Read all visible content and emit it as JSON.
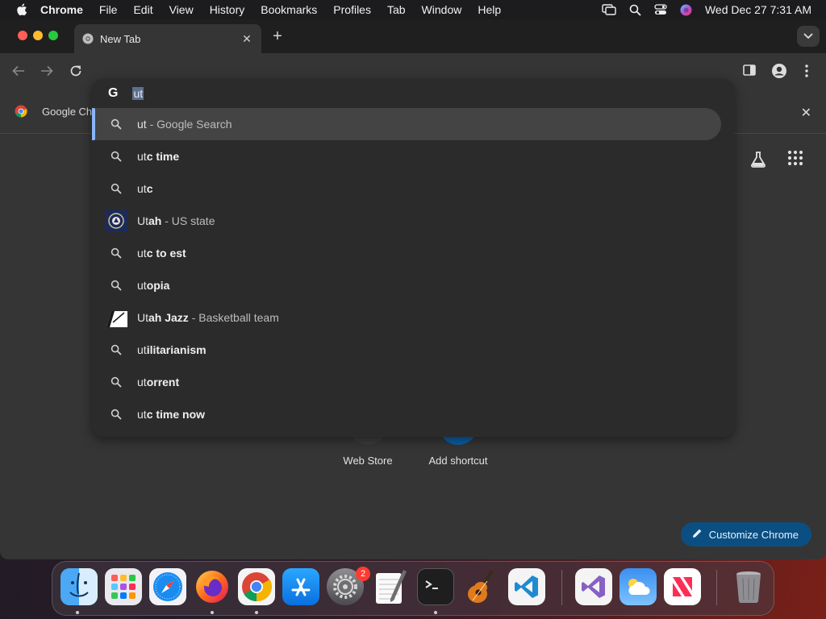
{
  "menubar": {
    "app_name": "Chrome",
    "menus": [
      "File",
      "Edit",
      "View",
      "History",
      "Bookmarks",
      "Profiles",
      "Tab",
      "Window",
      "Help"
    ],
    "clock": "Wed Dec 27  7:31 AM"
  },
  "tab": {
    "title": "New Tab",
    "close_glyph": "✕",
    "new_tab_glyph": "+"
  },
  "omnibox": {
    "logo": "G",
    "typed": "ut",
    "suggestions": [
      {
        "kind": "search",
        "typed": "ut",
        "rest": "",
        "detail": " - Google Search"
      },
      {
        "kind": "search",
        "typed": "ut",
        "rest": "c time",
        "detail": ""
      },
      {
        "kind": "search",
        "typed": "ut",
        "rest": "c",
        "detail": ""
      },
      {
        "kind": "entity",
        "icon": "utah-seal-icon",
        "typed": "Ut",
        "rest": "ah",
        "detail": " - US state"
      },
      {
        "kind": "search",
        "typed": "ut",
        "rest": "c to est",
        "detail": ""
      },
      {
        "kind": "search",
        "typed": "ut",
        "rest": "opia",
        "detail": ""
      },
      {
        "kind": "entity",
        "icon": "utah-jazz-logo-icon",
        "typed": "Ut",
        "rest": "ah Jazz",
        "detail": " - Basketball team"
      },
      {
        "kind": "search",
        "typed": "ut",
        "rest": "ilitarianism",
        "detail": ""
      },
      {
        "kind": "search",
        "typed": "ut",
        "rest": "orrent",
        "detail": ""
      },
      {
        "kind": "search",
        "typed": "ut",
        "rest": "c time now",
        "detail": ""
      }
    ]
  },
  "bookmark_bar": {
    "item_label": "Google Ch",
    "close_glyph": "✕"
  },
  "ntp": {
    "shortcuts": [
      {
        "label": "Web Store"
      },
      {
        "label": "Add shortcut",
        "glyph": "+"
      }
    ],
    "customize_label": "Customize Chrome"
  },
  "dock": {
    "apps": [
      "Finder",
      "Launchpad",
      "Safari",
      "Firefox",
      "Google Chrome",
      "App Store",
      "System Settings",
      "TextEdit",
      "Terminal",
      "GarageBand",
      "Visual Studio Code",
      "Visual Studio",
      "Weather",
      "News",
      "Trash"
    ],
    "settings_badge": "2"
  },
  "colors": {
    "accent_blue": "#8ab4f8",
    "customize_bg": "#0b4f82",
    "add_shortcut_bg": "#0b5ea8",
    "badge_red": "#ff3b30"
  }
}
